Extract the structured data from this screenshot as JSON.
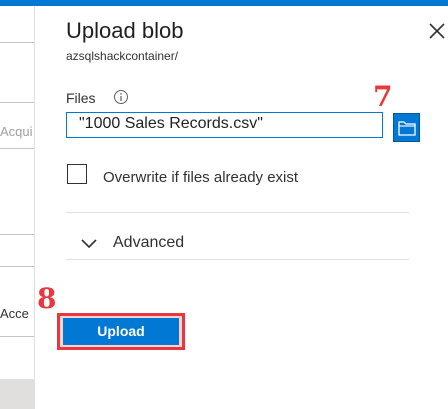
{
  "background": {
    "text_row1": "Acqui",
    "text_row2": "Acce"
  },
  "blade": {
    "title": "Upload blob",
    "subtitle": "azsqlshackcontainer/",
    "files_label": "Files",
    "file_value": "\"1000 Sales Records.csv\"",
    "overwrite_label": "Overwrite if files already exist",
    "overwrite_checked": false,
    "advanced_label": "Advanced",
    "upload_label": "Upload"
  },
  "annotations": {
    "step_browse": "7",
    "step_upload": "8"
  },
  "colors": {
    "accent": "#0078d4",
    "annotation": "#e8383d"
  }
}
